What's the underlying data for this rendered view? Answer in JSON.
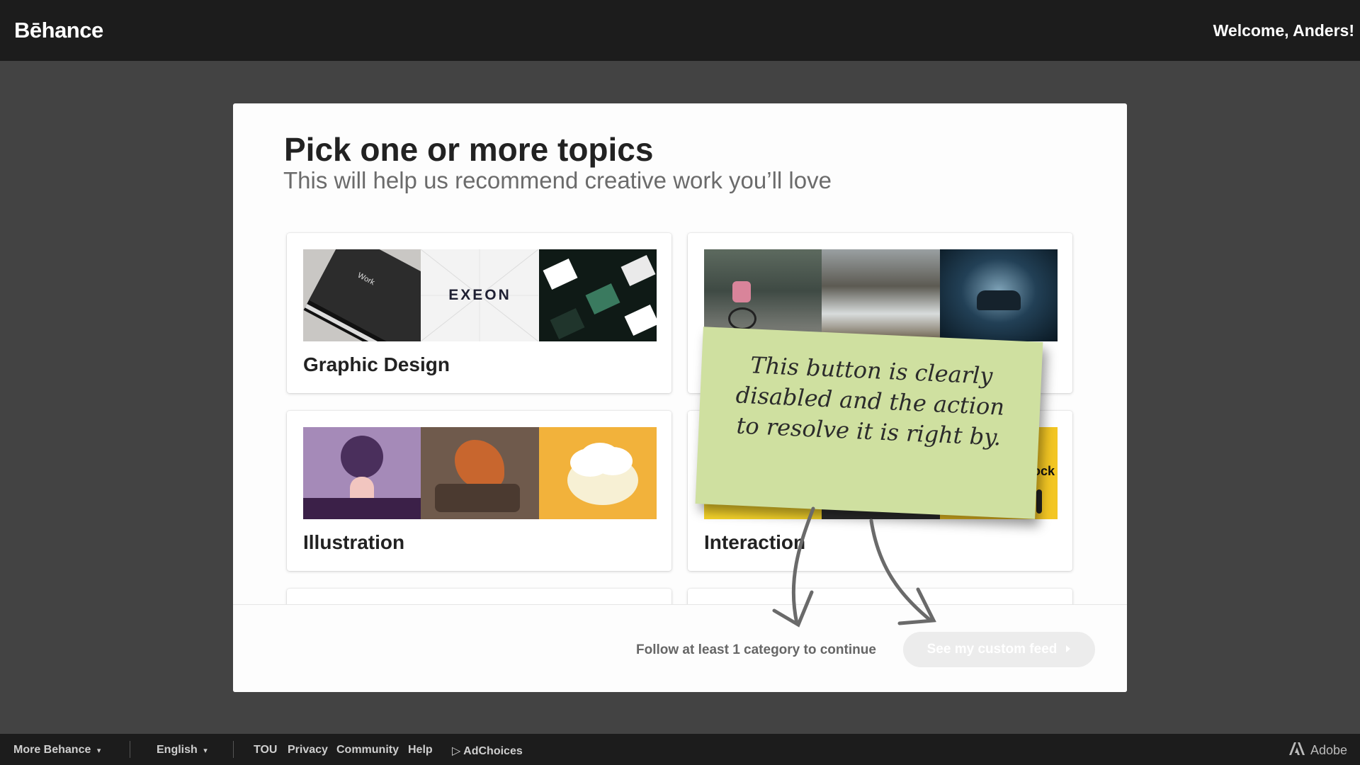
{
  "header": {
    "logo": "Bēhance",
    "welcome": "Welcome, Anders!"
  },
  "modal": {
    "title": "Pick one or more topics",
    "subtitle": "This will help us recommend creative work you’ll love",
    "cards": [
      {
        "label": "Graphic Design"
      },
      {
        "label": ""
      },
      {
        "label": "Illustration"
      },
      {
        "label": "Interaction"
      }
    ],
    "thumb_text": {
      "exeon": "EXEON",
      "work": "Work",
      "ock": "ock"
    },
    "follow_hint": "Follow at least 1 category to continue",
    "cta_label": "See my custom feed"
  },
  "sticky_note": {
    "lines": [
      "This button is clearly",
      "disabled and the action",
      "to resolve it is right by."
    ]
  },
  "footer": {
    "more": "More Behance",
    "language": "English",
    "links": [
      "TOU",
      "Privacy",
      "Community",
      "Help"
    ],
    "adchoices": "AdChoices",
    "adobe": "Adobe"
  },
  "colors": {
    "topbar": "#1c1c1c",
    "backdrop": "#434343",
    "sticky": "#cfe0a0",
    "cta_disabled": "#ececec"
  },
  "icons": [
    "chevron-down-icon",
    "adchoices-icon",
    "adobe-logo-icon",
    "chevron-right-icon"
  ]
}
